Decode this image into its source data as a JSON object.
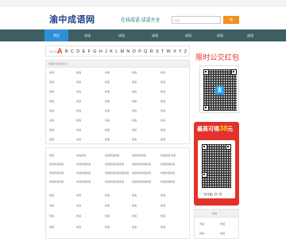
{
  "site": {
    "logo": "渝中成语网",
    "tagline": "在线成语 成语大全",
    "search_placeholder": "成语",
    "search_button": "搜"
  },
  "nav": [
    "首页",
    "成语",
    "成语",
    "成语",
    "成语",
    "成语",
    "成语",
    "成语"
  ],
  "alphabet": {
    "marker": "拼音查询:",
    "first": "A",
    "rest": "B C D E F G H J K L M N O P Q R S T W X Y Z"
  },
  "list1": {
    "header": "成语大全成语大全",
    "cells": [
      "成语",
      "成语",
      "成语",
      "成语",
      "成语",
      "成语",
      "成语",
      "成语",
      "成语",
      "成语",
      "成语",
      "成语",
      "成语",
      "成语",
      "成语",
      "成语",
      "成语",
      "成语",
      "成语",
      "成语",
      "成语",
      "成语",
      "成语",
      "成语",
      "成语",
      "成语",
      "成语",
      "成语",
      "成语",
      "成语",
      "成语",
      "成语",
      "成语",
      "成语",
      "成语",
      "成语",
      "成语",
      "成语",
      "成语",
      "成语"
    ]
  },
  "list2": {
    "header_cells": [
      "成语",
      "成语成语",
      "成语成语成语",
      "成语成语成语",
      "成语成语 成语"
    ],
    "rows": [
      [
        "成语成语成语",
        "成语成语成语",
        "成语成语成语成语",
        "成语成语成语成语",
        "成语成语成语"
      ],
      [
        "成语成语成语",
        "成语成语成语",
        "成语成语成语成语成语",
        "成语成语成语成语",
        "成语成语成语"
      ],
      [
        "成语成语成语",
        "成语成语成语",
        "成语成语成语成语",
        "成语成语成语成语",
        "成语成语成语"
      ]
    ],
    "grid": [
      "成语",
      "成语",
      "成语",
      "成语",
      "成语",
      "成语",
      "成语",
      "成语",
      "成语",
      "成语",
      "成语",
      "成语",
      "成语",
      "成语",
      "成语",
      "成语",
      "成语",
      "成语",
      "成语",
      "成语"
    ]
  },
  "promo1": {
    "title": "限时公交红包"
  },
  "promo2": {
    "title_prefix": "最高可得",
    "amount": "38",
    "title_suffix": "元",
    "footer": "「支付宝」扫一扫"
  },
  "side_list": {
    "header": "成语",
    "items": [
      "成语",
      "成语",
      "成语",
      "成语"
    ]
  },
  "colors": {
    "nav": "#3d5f63",
    "accent": "#2f8fd6",
    "search": "#f3911f",
    "red": "#e1332b",
    "logo": "#1f3f87"
  }
}
